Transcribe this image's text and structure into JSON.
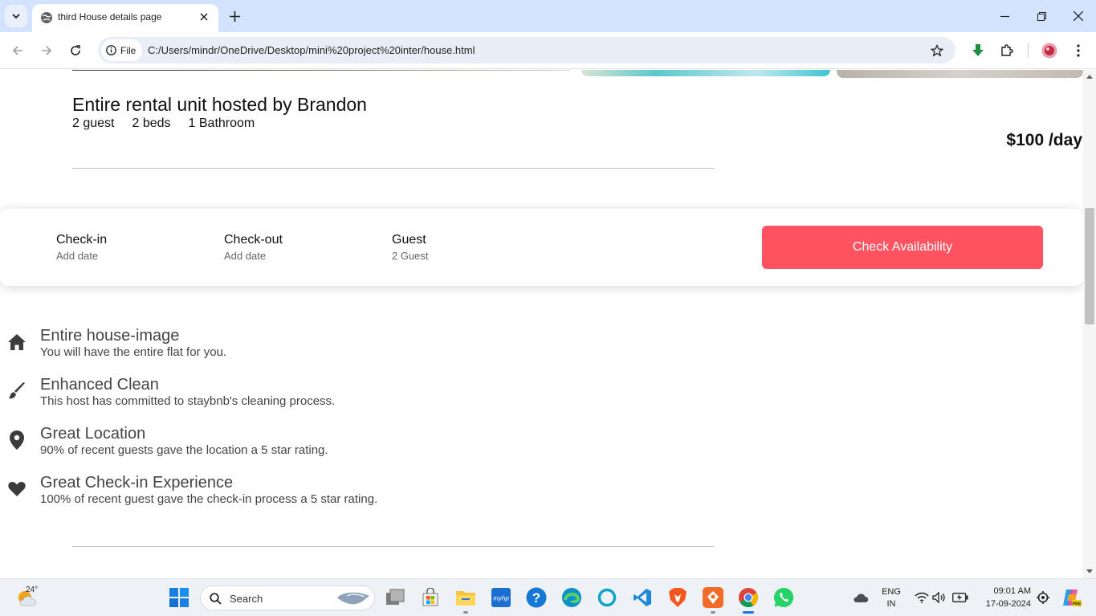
{
  "browser": {
    "tab_title": "third House details page",
    "file_chip": "File",
    "url": "C:/Users/mindr/OneDrive/Desktop/mini%20project%20inter/house.html"
  },
  "listing": {
    "title": "Entire rental unit hosted by Brandon",
    "stats": [
      "2 guest",
      "2 beds",
      "1 Bathroom"
    ],
    "price": "$100 /day"
  },
  "booking": {
    "checkin": {
      "label": "Check-in",
      "value": "Add date"
    },
    "checkout": {
      "label": "Check-out",
      "value": "Add date"
    },
    "guest": {
      "label": "Guest",
      "value": "2 Guest"
    },
    "button": "Check Availability",
    "button_color": "#ff5361"
  },
  "features": [
    {
      "icon": "house-icon",
      "title": "Entire house-image",
      "desc": "You will have the entire flat for you."
    },
    {
      "icon": "paintbrush-icon",
      "title": "Enhanced Clean",
      "desc": "This host has committed to staybnb's cleaning process."
    },
    {
      "icon": "location-pin-icon",
      "title": "Great Location",
      "desc": "90% of recent guests gave the location a 5 star rating."
    },
    {
      "icon": "heart-icon",
      "title": "Great Check-in Experience",
      "desc": "100% of recent guest gave the check-in process a 5 star rating."
    }
  ],
  "taskbar": {
    "temperature": "24°",
    "search_label": "Search",
    "language": "ENG",
    "region": "IN",
    "time": "09:01 AM",
    "date": "17-09-2024"
  }
}
